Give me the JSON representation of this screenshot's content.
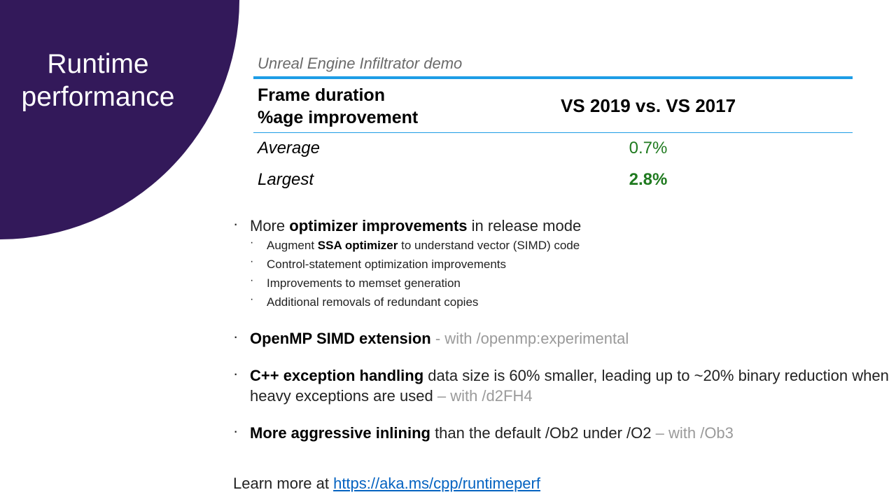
{
  "slide": {
    "title_line1": "Runtime",
    "title_line2": "performance",
    "accent_color": "#33195a"
  },
  "table": {
    "caption": "Unreal Engine Infiltrator demo",
    "header_left_line1": "Frame duration",
    "header_left_line2": "%age improvement",
    "header_right": "VS 2019 vs. VS 2017",
    "rows": [
      {
        "label": "Average",
        "value": "0.7%"
      },
      {
        "label": "Largest",
        "value": "2.8%"
      }
    ],
    "value_color": "#1f7a1f",
    "rule_color": "#1e9de6"
  },
  "bullets": {
    "b1": {
      "pre": "More ",
      "strong": "optimizer improvements",
      "post": " in release mode"
    },
    "sub": [
      {
        "pre": "Augment ",
        "strong": "SSA optimizer",
        "post": " to understand vector (SIMD) code"
      },
      {
        "text": "Control-statement optimization improvements"
      },
      {
        "text": "Improvements to memset generation"
      },
      {
        "text": "Additional removals of redundant copies"
      }
    ],
    "b2": {
      "strong": "OpenMP SIMD extension",
      "dim": " - with /openmp:experimental"
    },
    "b3": {
      "strong": "C++ exception handling",
      "post": " data size is 60% smaller, leading up to ~20% binary reduction when heavy exceptions are used",
      "dim": " – with /d2FH4"
    },
    "b4": {
      "strong": "More aggressive inlining",
      "post": " than the default /Ob2 under /O2",
      "dim": " – with /Ob3"
    }
  },
  "footer": {
    "learn_text": "Learn more at ",
    "link_text": "https://aka.ms/cpp/runtimeperf"
  }
}
